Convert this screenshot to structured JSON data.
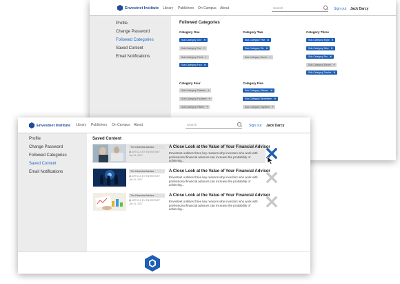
{
  "brand": {
    "name": "Envestnet Institute",
    "accent": "#1f5fb5"
  },
  "nav": {
    "library": "Library",
    "publishers": "Publishers",
    "campus": "On Campus",
    "about": "About"
  },
  "search": {
    "placeholder": "Search"
  },
  "account": {
    "signout": "Sign out",
    "user": "Jack Darcy"
  },
  "sidebar": {
    "items": [
      "Profile",
      "Change Password",
      "Followed Categories",
      "Saved Content",
      "Email Notifications"
    ]
  },
  "followed": {
    "title": "Followed Categories",
    "categories": [
      {
        "name": "Category One",
        "tags": [
          {
            "label": "Sub-Category One",
            "selected": true
          },
          {
            "label": "Sub-Category Two",
            "selected": false
          },
          {
            "label": "Sub-Category Three",
            "selected": false
          },
          {
            "label": "Sub-Category Four",
            "selected": true
          }
        ]
      },
      {
        "name": "Category Two",
        "tags": [
          {
            "label": "Sub-Category Five",
            "selected": true
          },
          {
            "label": "Sub-Category Six",
            "selected": true
          },
          {
            "label": "Sub-Category Seven",
            "selected": false
          }
        ]
      },
      {
        "name": "Category Three",
        "tags": [
          {
            "label": "Sub-Category Eight",
            "selected": true
          },
          {
            "label": "Sub-Category Nine",
            "selected": true
          },
          {
            "label": "Sub-Category Ten",
            "selected": true
          },
          {
            "label": "Sub-Category Eleven",
            "selected": false
          },
          {
            "label": "Sub-Category Twelve",
            "selected": true
          }
        ]
      },
      {
        "name": "Category Four",
        "tags": [
          {
            "label": "Sub-Category Thirteen",
            "selected": false
          },
          {
            "label": "Sub-Category Fourteen",
            "selected": false
          },
          {
            "label": "Sub-Category Fifteen",
            "selected": false
          }
        ]
      },
      {
        "name": "Category Five",
        "tags": [
          {
            "label": "Sub-Category Sixteen",
            "selected": true
          },
          {
            "label": "Sub-Category Seventeen",
            "selected": true
          },
          {
            "label": "Sub-Category Eighteen",
            "selected": false
          }
        ]
      }
    ]
  },
  "saved": {
    "title": "Saved Content",
    "items": [
      {
        "source": "The Essential Advisor",
        "type": "ARTICLE BY ENVESTNET",
        "date": "Jan 31, 2017",
        "title": "A Close Look at the Value of Your Financial Advisor",
        "desc": "Envestnet outlines three key reasons why investors who work with professional financial advisors can increase the probability of achieving...",
        "remove_color": "#1f5fb5"
      },
      {
        "source": "The Essential Advisor",
        "type": "ARTICLE BY ENVESTNET",
        "date": "Jan 31, 2017",
        "title": "A Close Look at the Value of Your Financial Advisor",
        "desc": "Envestnet outlines three key reasons why investors who work with professional financial advisors can increase the probability of achieving...",
        "remove_color": "#c8c8c8"
      },
      {
        "source": "The Essential Advisor",
        "type": "ARTICLE BY ENVESTNET",
        "date": "Jan 31, 2017",
        "title": "A Close Look at the Value of Your Financial Advisor",
        "desc": "Envestnet outlines three key reasons why investors who work with professional financial advisors can increase the probability of achieving...",
        "remove_color": "#c8c8c8"
      }
    ]
  }
}
